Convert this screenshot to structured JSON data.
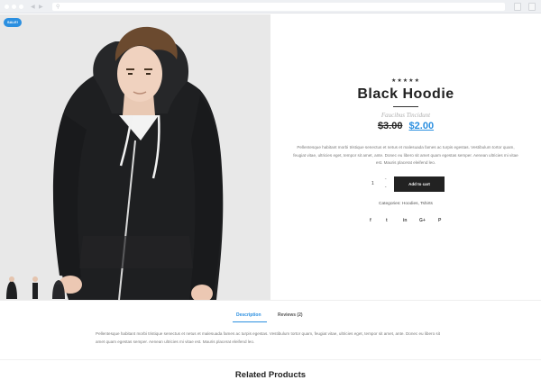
{
  "product": {
    "sale_badge": "SALE!",
    "rating_stars": "★★★★★",
    "title": "Black Hoodie",
    "brand": "Faucibus Tincidunt",
    "old_price": "$3.00",
    "new_price": "$2.00",
    "description": "Pellentesque habitant morbi tristique senectus et netus et malesuada fames ac turpis egestas. Vestibulum tortor quam, feugiat vitae, ultricies eget, tempor sit amet, ante. Donec eu libero sit amet quam egestas semper. Aenean ultricies mi vitae est. Mauris placerat eleifend leo.",
    "quantity": "1",
    "add_to_cart": "Add to cart",
    "categories": "Categories: Hoodies, Tshirts"
  },
  "icons": {
    "qty_up": "⌃",
    "qty_down": "⌄",
    "facebook": "f",
    "twitter": "t",
    "linkedin": "in",
    "googleplus": "G+",
    "pinterest": "P"
  },
  "tabs": [
    {
      "label": "Description",
      "active": true
    },
    {
      "label": "Reviews (2)",
      "active": false
    }
  ],
  "tab_content": "Pellentesque habitant morbi tristique senectus et netus et malesuada fames ac turpis egestas. Vestibulum tortor quam, feugiat vitae, ultricies eget, tempor sit amet, ante. Donec eu libero sit amet quam egestas semper. Aenean ultricies mi vitae est. Mauris placerat eleifend leo.",
  "related_title": "Related Products",
  "colors": {
    "accent": "#2b8fe0",
    "dark_button": "#222222",
    "image_bg": "#e8e8e8"
  }
}
